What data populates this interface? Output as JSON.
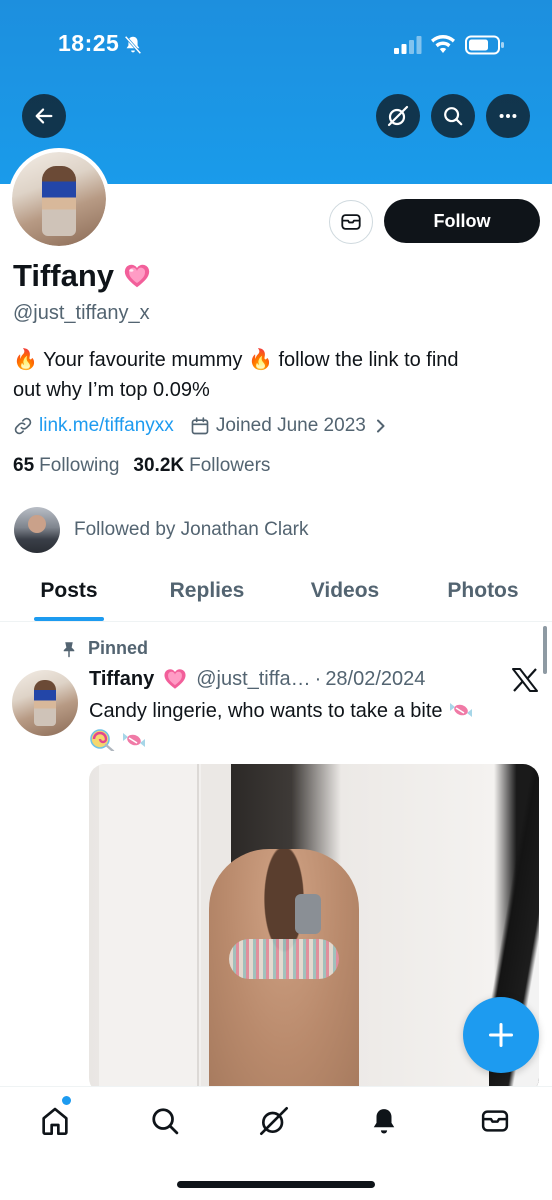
{
  "status_bar": {
    "time": "18:25",
    "icons": [
      "bell-slash-icon",
      "cellular-signal-icon",
      "wifi-icon",
      "battery-icon"
    ]
  },
  "header": {
    "banner_color": "#1d9bf0",
    "actions": [
      "back-arrow-icon",
      "grok-icon",
      "search-icon",
      "more-icon"
    ]
  },
  "profile": {
    "name": "Tiffany",
    "name_emoji": "pink-heart-icon",
    "handle": "@just_tiffany_x",
    "bio_line1": "🔥 Your favourite mummy 🔥 follow the link to find",
    "bio_line2": "out why I’m top 0.09%",
    "link": "link.me/tiffanyxx",
    "joined": "Joined June 2023",
    "following_count": "65",
    "following_label": "Following",
    "followers_count": "30.2K",
    "followers_label": "Followers",
    "followed_by": "Followed by Jonathan Clark",
    "follow_button": "Follow"
  },
  "tabs": [
    {
      "label": "Posts",
      "active": true
    },
    {
      "label": "Replies",
      "active": false
    },
    {
      "label": "Videos",
      "active": false
    },
    {
      "label": "Photos",
      "active": false
    }
  ],
  "pinned_post": {
    "pinned_label": "Pinned",
    "author_name": "Tiffany",
    "author_handle": "@just_tiffa…",
    "separator": "·",
    "date": "28/02/2024",
    "text": "Candy lingerie, who wants to take a bite"
  },
  "bottom_nav": {
    "items": [
      "home-icon",
      "search-icon",
      "grok-icon",
      "notifications-icon",
      "messages-icon"
    ],
    "accent": "#1d9bf0"
  }
}
